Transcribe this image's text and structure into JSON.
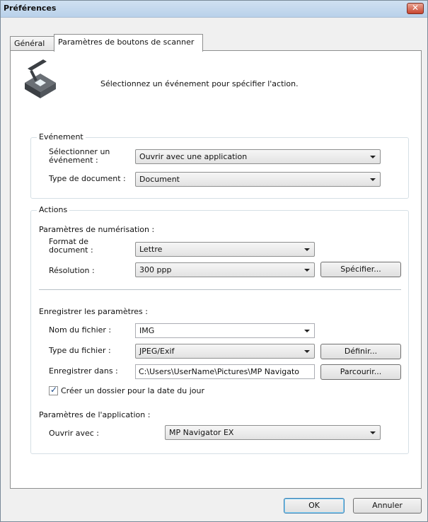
{
  "window": {
    "title": "Préférences"
  },
  "tabs": [
    {
      "label": "Général"
    },
    {
      "label": "Paramètres de boutons de scanner"
    }
  ],
  "header": {
    "text": "Sélectionnez un événement pour spécifier l'action."
  },
  "event_group": {
    "title": "Evénement",
    "select_event_label": "Sélectionner un événement :",
    "select_event_value": "Ouvrir avec une application",
    "doc_type_label": "Type de document :",
    "doc_type_value": "Document"
  },
  "actions_group": {
    "title": "Actions",
    "scan_settings_title": "Paramètres de numérisation :",
    "doc_size_label": "Format de document :",
    "doc_size_value": "Lettre",
    "resolution_label": "Résolution :",
    "resolution_value": "300 ppp",
    "specify_button": "Spécifier...",
    "save_settings_title": "Enregistrer les paramètres :",
    "file_name_label": "Nom du fichier :",
    "file_name_value": "IMG",
    "file_type_label": "Type du fichier :",
    "file_type_value": "JPEG/Exif",
    "define_button": "Définir...",
    "save_in_label": "Enregistrer dans :",
    "save_in_value": "C:\\Users\\UserName\\Pictures\\MP Navigato",
    "browse_button": "Parcourir...",
    "date_folder_label": "Créer un dossier pour la date du jour",
    "date_folder_checked": true,
    "app_settings_title": "Paramètres de l'application :",
    "open_with_label": "Ouvrir avec :",
    "open_with_value": "MP Navigator EX"
  },
  "footer": {
    "ok": "OK",
    "cancel": "Annuler"
  },
  "icons": {
    "close": "close-icon",
    "scanner": "scanner-icon",
    "check": "check-icon"
  },
  "colors": {
    "accent": "#3c7fb1",
    "titlebar": "#b9d1ea",
    "close": "#c8442f"
  }
}
